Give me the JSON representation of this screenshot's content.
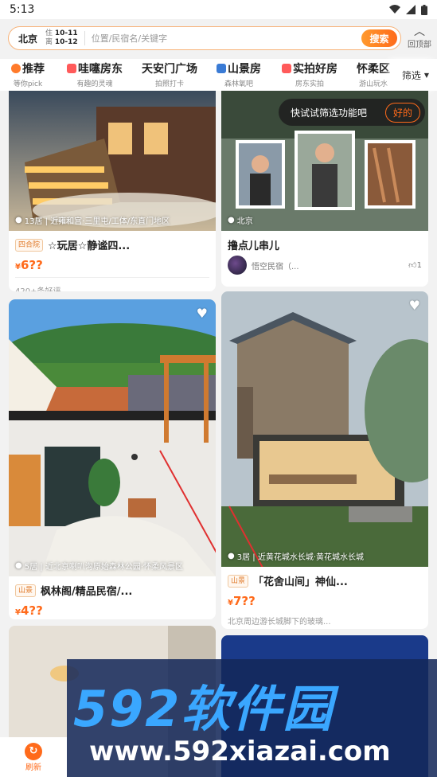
{
  "status_bar": {
    "time": "5:13"
  },
  "search": {
    "city": "北京",
    "checkin_label": "住",
    "checkin_date": "10-11",
    "checkout_label": "离",
    "checkout_date": "10-12",
    "placeholder": "位置/民宿名/关键字",
    "button": "搜索"
  },
  "back_to_top": "回顶部",
  "categories": [
    {
      "title": "推荐",
      "subtitle": "等你pick",
      "icon": "star-icon"
    },
    {
      "title": "哇噻房东",
      "subtitle": "有趣的灵魂",
      "icon": "house-icon"
    },
    {
      "title": "天安门广场",
      "subtitle": "拍照打卡",
      "icon": ""
    },
    {
      "title": "山景房",
      "subtitle": "森林氧吧",
      "icon": "mountain-icon"
    },
    {
      "title": "实拍好房",
      "subtitle": "房东实拍",
      "icon": "camera-icon"
    },
    {
      "title": "怀柔区",
      "subtitle": "游山玩水",
      "icon": ""
    }
  ],
  "filter_label": "筛选",
  "tooltip": {
    "text": "快试试筛选功能吧",
    "button": "好的"
  },
  "listings": [
    {
      "location": "13居 | 近雍和宫·三里屯/工体/东直门地区",
      "tag": "四合院",
      "title": "☆玩居☆静谧四...",
      "price": "6??",
      "note": "420+条好评"
    },
    {
      "location": "北京",
      "title": "撸点儿串儿",
      "author": "悟空民宿（...",
      "likes": "1"
    },
    {
      "location": "5居 | 近北京喇叭沟原始森林公园·怀柔风景区",
      "tag": "山景",
      "title": "枫林阁/精品民宿/...",
      "price": "4??"
    },
    {
      "location": "3居 | 近黄花城水长城·黄花城水长城",
      "tag": "山景",
      "title": "「花舍山间」神仙...",
      "price": "7??",
      "note": "北京周边游长城脚下的玻璃..."
    }
  ],
  "watermark": {
    "logo": "592软件园",
    "url": "www.592xiazai.com"
  },
  "bottom_nav": {
    "refresh": "刷新"
  },
  "colors": {
    "accent": "#ff6a1a",
    "tag": "#e07a2a"
  }
}
